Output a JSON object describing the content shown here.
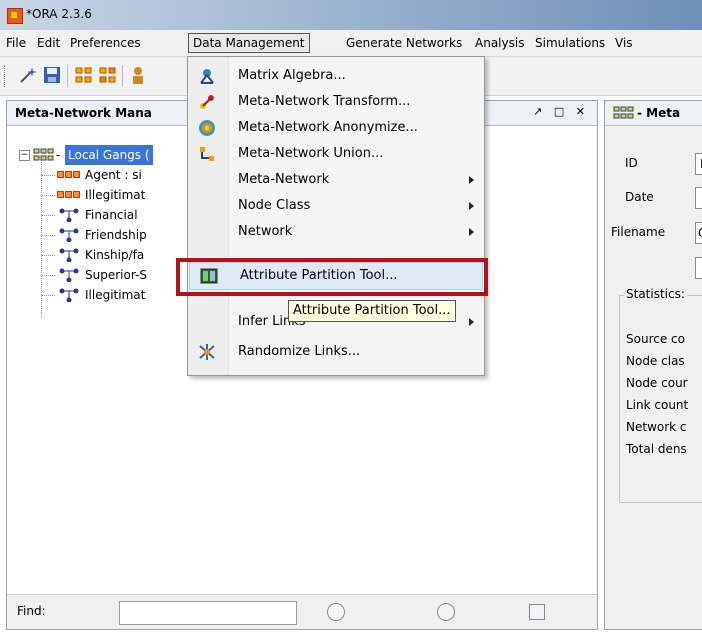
{
  "window": {
    "title": "*ORA 2.3.6"
  },
  "menubar": {
    "items": [
      "File",
      "Edit",
      "Preferences",
      "Data Management",
      "Generate Networks",
      "Analysis",
      "Simulations",
      "Vis"
    ]
  },
  "left_panel": {
    "title": "Meta-Network Mana",
    "controls": "↗ □ ✕",
    "tree": {
      "root_label": "Local Gangs (",
      "root_expander": "−",
      "root_dash": "-",
      "children": [
        {
          "label": "Agent : si",
          "icon": "agent-nodeset-icon"
        },
        {
          "label": "Illegitimat",
          "icon": "agent-nodeset-icon"
        },
        {
          "label": "Financial",
          "icon": "network-icon"
        },
        {
          "label": "Friendship",
          "icon": "network-icon"
        },
        {
          "label": "Kinship/fa",
          "icon": "network-icon"
        },
        {
          "label": "Superior-S",
          "icon": "network-icon"
        },
        {
          "label": "Illegitimat",
          "icon": "network-icon"
        }
      ]
    },
    "find": {
      "label": "Find:",
      "value": ""
    }
  },
  "right_panel": {
    "title": "- Meta",
    "fields": [
      {
        "label": "ID",
        "value": "L"
      },
      {
        "label": "Date",
        "value": ""
      },
      {
        "label": "Filename",
        "value": "C"
      }
    ],
    "statistics_label": "Statistics:",
    "stats": [
      "Source co",
      "Node clas",
      "Node cour",
      "Link count",
      "Network c",
      "Total dens"
    ]
  },
  "dropdown": {
    "items": [
      {
        "label": "Matrix Algebra...",
        "icon": "matrix-algebra-icon",
        "submenu": false
      },
      {
        "label": "Meta-Network Transform...",
        "icon": "transform-icon",
        "submenu": false
      },
      {
        "label": "Meta-Network Anonymize...",
        "icon": "anonymize-icon",
        "submenu": false
      },
      {
        "label": "Meta-Network Union...",
        "icon": "union-icon",
        "submenu": false
      },
      {
        "label": "Meta-Network",
        "icon": "",
        "submenu": true
      },
      {
        "label": "Node Class",
        "icon": "",
        "submenu": true
      },
      {
        "label": "Network",
        "icon": "",
        "submenu": true
      },
      {
        "label": "Attribute Partition Tool...",
        "icon": "attribute-partition-icon",
        "submenu": false,
        "highlighted": true
      },
      {
        "label": "Infer Links",
        "icon": "",
        "submenu": true
      },
      {
        "label": "Randomize Links...",
        "icon": "randomize-links-icon",
        "submenu": false
      }
    ]
  },
  "tooltip": {
    "text": "Attribute Partition Tool..."
  },
  "colors": {
    "highlight_box": "#b01418",
    "selection": "#3875d7",
    "tooltip_bg": "#ffffe1"
  }
}
